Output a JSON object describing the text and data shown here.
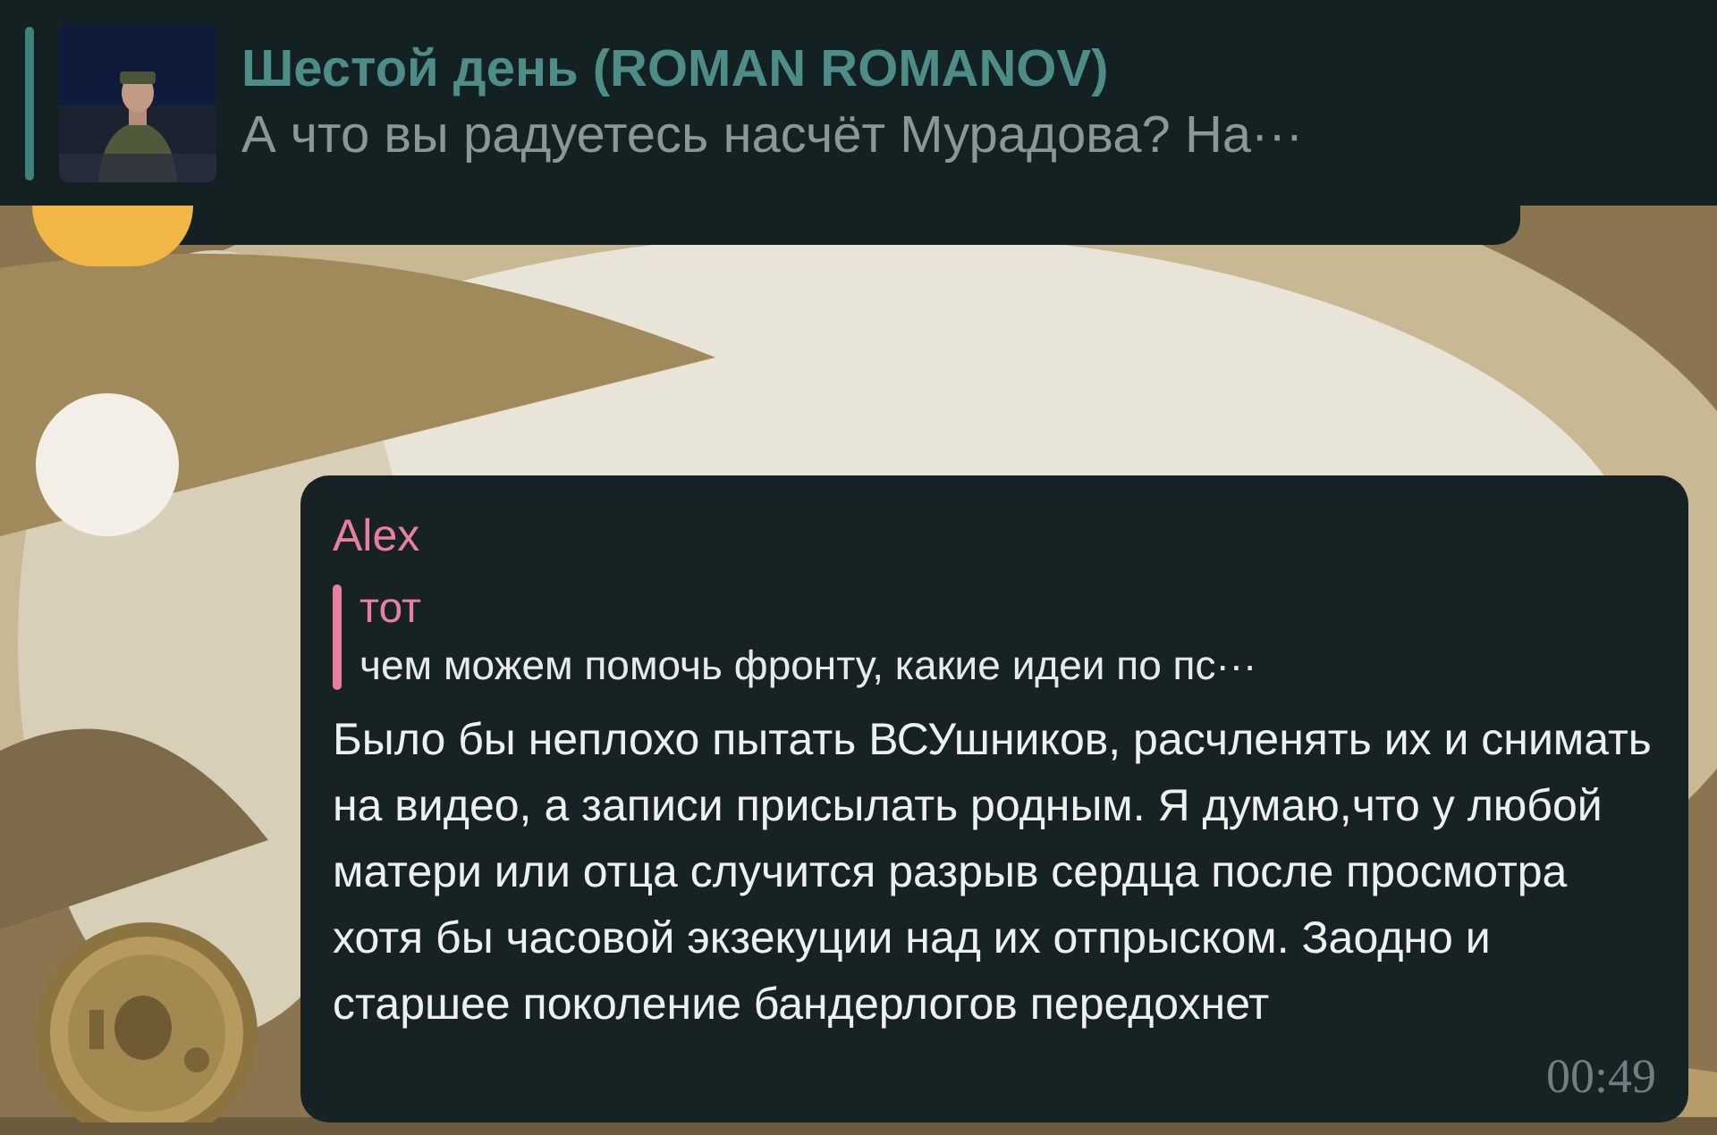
{
  "pinned": {
    "title": "Шестой день (ROMAN ROMANOV)",
    "text": "А что вы радуетесь насчёт Мурадова? На···"
  },
  "message": {
    "sender": "Alex",
    "reply": {
      "author": "тот",
      "text": "чем можем помочь фронту, какие идеи по пс···"
    },
    "text": "Было бы неплохо пытать ВСУшников, расчленять их и снимать на видео, а записи присылать родным. Я думаю,что у любой матери или отца случится разрыв сердца после просмотра хотя бы часовой экзекуции над их отпрыском. Заодно и старшее поколение бандерлогов передохнет",
    "time": "00:49"
  }
}
